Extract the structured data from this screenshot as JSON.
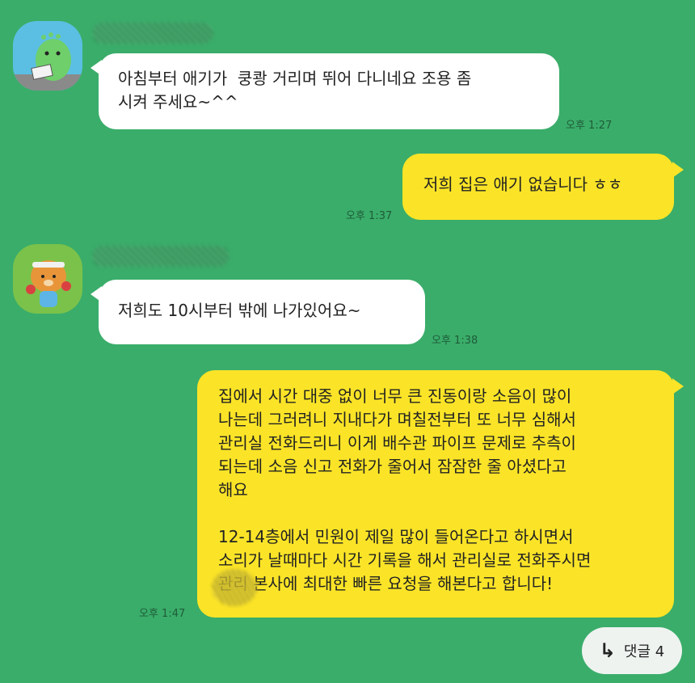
{
  "messages": [
    {
      "direction": "in",
      "text": "아침부터 애기가  쿵쾅 거리며 뛰어 다니네요 조용 좀\n시켜 주세요~^^",
      "time": "오후 1:27",
      "avatar_icon": "dinosaur-icon"
    },
    {
      "direction": "out",
      "text": "저희 집은 애기 없습니다 ㅎㅎ",
      "time": "오후 1:37"
    },
    {
      "direction": "in",
      "text": "저희도 10시부터 밖에 나가있어요~",
      "time": "오후 1:38",
      "avatar_icon": "lion-icon"
    },
    {
      "direction": "out",
      "text": "집에서 시간 대중 없이 너무 큰 진동이랑 소음이 많이\n나는데 그러려니 지내다가 며칠전부터 또 너무 심해서\n관리실 전화드리니 이게 배수관 파이프 문제로 추측이\n되는데 소음 신고 전화가 줄어서 잠잠한 줄 아셨다고\n해요\n\n12-14층에서 민원이 제일 많이 들어온다고 하시면서\n소리가 날때마다 시간 기록을 해서 관리실로 전화주시면\n관리 본사에 최대한 빠른 요청을 해본다고 합니다!",
      "time": "오후 1:47"
    }
  ],
  "comment_button": {
    "arrow": "↳",
    "label": "댓글 4"
  },
  "colors": {
    "background": "#3aad6a",
    "incoming_bubble": "#ffffff",
    "outgoing_bubble": "#fbe427"
  }
}
